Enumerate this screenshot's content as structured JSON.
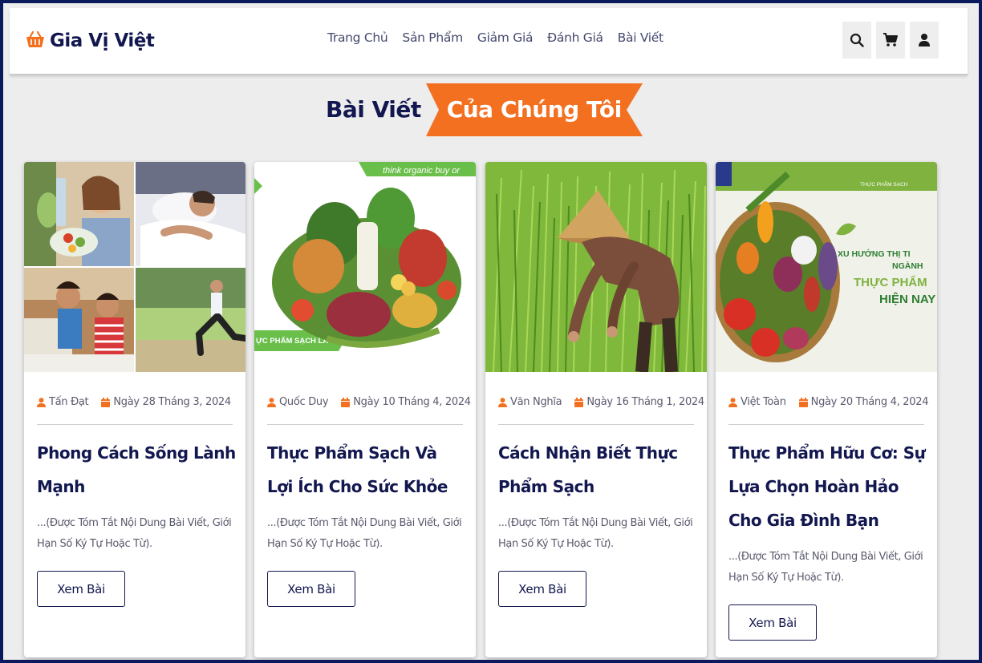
{
  "brand": {
    "name": "Gia Vị Việt",
    "accent": "#f37021",
    "navy": "#12174f"
  },
  "nav": {
    "items": [
      "Trang Chủ",
      "Sản Phẩm",
      "Giảm Giá",
      "Đánh Giá",
      "Bài Viết"
    ]
  },
  "header_icons": [
    "search-icon",
    "cart-icon",
    "user-icon"
  ],
  "section": {
    "title_plain": "Bài Viết",
    "title_highlight": "Của Chúng Tôi"
  },
  "posts": [
    {
      "author": "Tấn Đạt",
      "date": "Ngày 28 Tháng 3, 2024",
      "title": "Phong Cách Sống Lành Mạnh",
      "excerpt": "...(Được Tóm Tắt Nội Dung Bài Viết, Giới Hạn Số Ký Tự Hoặc Từ).",
      "button": "Xem Bài"
    },
    {
      "author": "Quốc Duy",
      "date": "Ngày 10 Tháng 4, 2024",
      "title": "Thực Phẩm Sạch Và Lợi Ích Cho Sức Khỏe",
      "excerpt": "...(Được Tóm Tắt Nội Dung Bài Viết, Giới Hạn Số Ký Tự Hoặc Từ).",
      "button": "Xem Bài",
      "image_text": {
        "banner": "think organic buy or",
        "caption": "ỰC PHẨM SẠCH LÀ GÌ?"
      }
    },
    {
      "author": "Văn Nghĩa",
      "date": "Ngày 16 Tháng 1, 2024",
      "title": "Cách Nhận Biết Thực Phẩm Sạch",
      "excerpt": "...(Được Tóm Tắt Nội Dung Bài Viết, Giới Hạn Số Ký Tự Hoặc Từ).",
      "button": "Xem Bài"
    },
    {
      "author": "Việt Toàn",
      "date": "Ngày 20 Tháng 4, 2024",
      "title": "Thực Phẩm Hữu Cơ: Sự Lựa Chọn Hoàn Hảo Cho Gia Đình Bạn",
      "excerpt": "...(Được Tóm Tắt Nội Dung Bài Viết, Giới Hạn Số Ký Tự Hoặc Từ).",
      "button": "Xem Bài",
      "image_text": {
        "tag": "THỰC PHẨM SẠCH",
        "line1": "XU HƯỚNG THỊ TI",
        "line2": "NGÀNH",
        "line3": "THỰC PHẨM",
        "line4": "HIỆN NAY"
      }
    }
  ]
}
